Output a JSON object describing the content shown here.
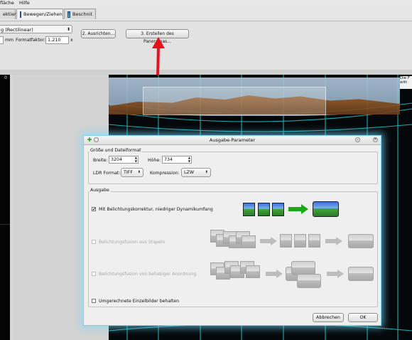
{
  "menubar": {
    "item1": "fläche",
    "item2": "Hilfe"
  },
  "tabs": [
    {
      "label": "ektien"
    },
    {
      "label": "Bewegen/Ziehen"
    },
    {
      "label": "Beschnit"
    }
  ],
  "toolbar": {
    "projection": "g (Rectilinear)",
    "unit": "mm",
    "crop_factor_label": "Formatfaktor:",
    "crop_factor_value": "1,210",
    "crop_factor_suffix": "x",
    "align_button": "2. Ausrichten...",
    "create_button": "3. Erstellen des Panoramas..."
  },
  "left_panel": {
    "marker": "0"
  },
  "right_label": {
    "line1": "Die F",
    "line2": "witt"
  },
  "dialog": {
    "title": "Ausgabe-Parameter",
    "size_group": {
      "title": "Größe und Dateiformat",
      "width_label": "Breite:",
      "width_value": "3204",
      "height_label": "Höhe:",
      "height_value": "734",
      "ldr_format_label": "LDR Format:",
      "ldr_format_value": "TIFF",
      "compression_label": "Kompression:",
      "compression_value": "LZW"
    },
    "output_group": {
      "title": "Ausgabe",
      "opt1": "Mit Belichtungskorrektur, niedriger Dynamikumfang",
      "opt1_checked": "✔",
      "opt2": "Belichtungsfusion aus Stapeln",
      "opt3": "Belichtungsfusion von beliebiger Anordnung",
      "opt4": "Umgerechnete Einzelbilder behalten"
    },
    "cancel_button": "Abbrechen",
    "ok_button": "OK"
  },
  "colors": {
    "arrow": "#e8111a",
    "dialog_glow": "#7fd3ee",
    "grid": "#1fc8c8"
  }
}
